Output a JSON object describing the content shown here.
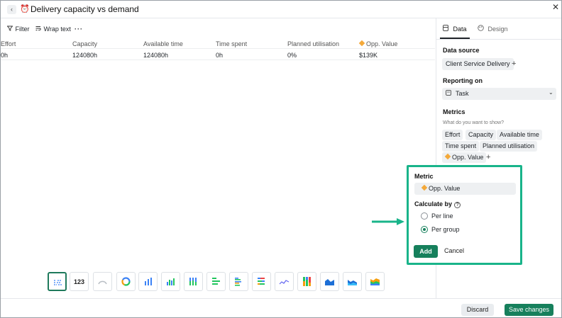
{
  "window": {
    "title": "Delivery capacity vs demand",
    "title_icon": "alarm-clock-icon",
    "back_icon": "chevron-left-icon",
    "close_icon": "close-icon"
  },
  "toolbar": {
    "filter_label": "Filter",
    "wrap_label": "Wrap text",
    "more_label": "···"
  },
  "table": {
    "headers": [
      "Effort",
      "Capacity",
      "Available time",
      "Time spent",
      "Planned utilisation",
      "Opp. Value"
    ],
    "row": [
      "0h",
      "124080h",
      "124080h",
      "0h",
      "0%",
      "$139K"
    ]
  },
  "chart_types": [
    {
      "name": "table-chart-icon",
      "selected": true
    },
    {
      "name": "number-chart-icon",
      "label": "123"
    },
    {
      "name": "gauge-chart-icon"
    },
    {
      "name": "donut-chart-icon"
    },
    {
      "name": "column-chart-icon"
    },
    {
      "name": "grouped-column-chart-icon"
    },
    {
      "name": "stacked-column-chart-icon"
    },
    {
      "name": "bar-chart-icon"
    },
    {
      "name": "grouped-bar-chart-icon"
    },
    {
      "name": "stacked-bar-chart-icon"
    },
    {
      "name": "line-chart-icon"
    },
    {
      "name": "percent-stacked-column-chart-icon"
    },
    {
      "name": "area-chart-icon"
    },
    {
      "name": "stacked-area-chart-icon"
    },
    {
      "name": "stacked-area-multi-chart-icon"
    }
  ],
  "footer": {
    "discard_label": "Discard",
    "save_label": "Save changes"
  },
  "panel": {
    "tabs": [
      {
        "label": "Data",
        "icon": "database-icon",
        "active": true
      },
      {
        "label": "Design",
        "icon": "palette-icon",
        "active": false
      }
    ],
    "data_source_label": "Data source",
    "data_source_value": "Client Service Delivery",
    "reporting_on_label": "Reporting on",
    "reporting_on_value": "Task",
    "metrics_label": "Metrics",
    "metrics_hint": "What do you want to show?",
    "metrics": [
      "Effort",
      "Capacity",
      "Available time",
      "Time spent",
      "Planned utilisation",
      "Opp. Value"
    ],
    "add_symbol": "+"
  },
  "popover": {
    "metric_label": "Metric",
    "metric_value": "Opp. Value",
    "calculate_label": "Calculate by",
    "help_symbol": "?",
    "options": [
      {
        "label": "Per line",
        "checked": false
      },
      {
        "label": "Per group",
        "checked": true
      }
    ],
    "add_label": "Add",
    "cancel_label": "Cancel"
  },
  "colors": {
    "accent": "#16805c",
    "highlight_border": "#19b48a",
    "opp_value_marker": "#f4a93a"
  }
}
